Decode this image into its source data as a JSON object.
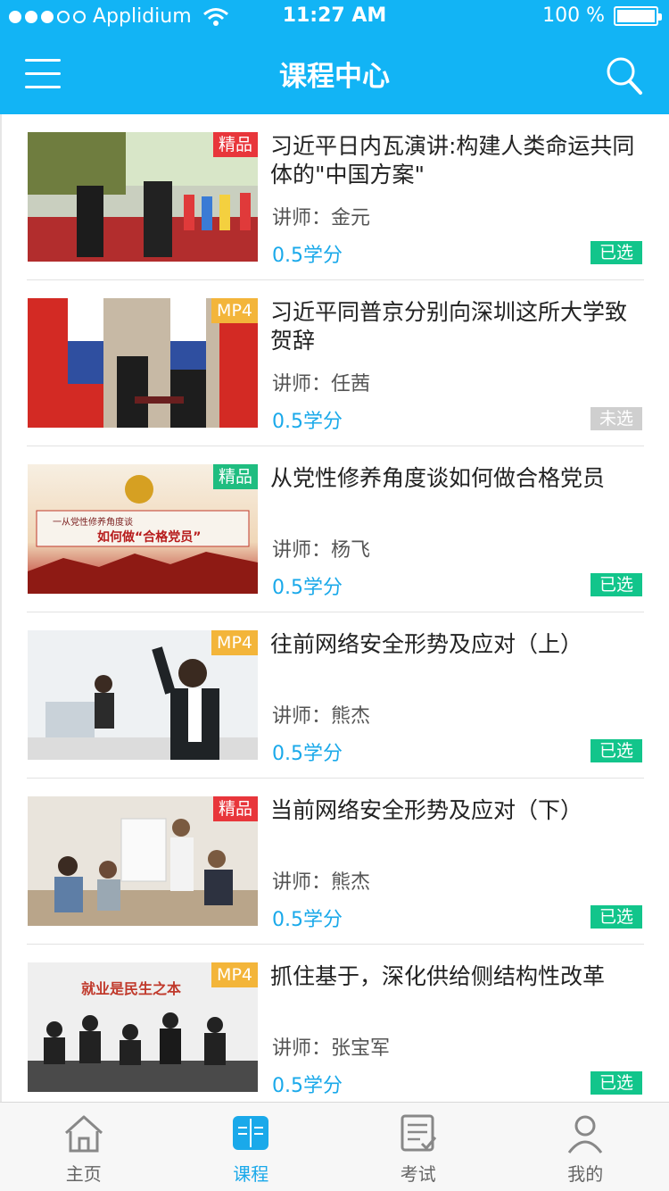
{
  "status_bar": {
    "carrier": "Applidium",
    "time": "11:27 AM",
    "battery": "100 %"
  },
  "nav": {
    "title": "课程中心"
  },
  "courses": [
    {
      "title": "习近平日内瓦演讲:构建人类命运共同体的\"中国方案\"",
      "badge": "精品",
      "teacher": "讲师：金元",
      "credit": "0.5学分",
      "state": "已选"
    },
    {
      "title": "习近平同普京分别向深圳这所大学致贺辞",
      "badge": "MP4",
      "teacher": "讲师：任茜",
      "credit": "0.5学分",
      "state": "未选"
    },
    {
      "title": " 从党性修养角度谈如何做合格党员",
      "badge": "精品",
      "teacher": "讲师：杨飞",
      "credit": "0.5学分",
      "state": "已选",
      "thumb_text_1": "一从党性修养角度谈",
      "thumb_text_2": "如何做“合格党员”"
    },
    {
      "title": "往前网络安全形势及应对（上）",
      "badge": "MP4",
      "teacher": "讲师：熊杰",
      "credit": "0.5学分",
      "state": "已选"
    },
    {
      "title": "当前网络安全形势及应对（下）",
      "badge": "精品",
      "teacher": "讲师：熊杰",
      "credit": "0.5学分",
      "state": "已选"
    },
    {
      "title": "抓住基于，深化供给侧结构性改革",
      "badge": "MP4",
      "teacher": "讲师：张宝军",
      "credit": "0.5学分",
      "state": "已选",
      "thumb_text_1": "就业是民生之本"
    }
  ],
  "tabs": [
    {
      "label": "主页",
      "icon": "home-icon"
    },
    {
      "label": "课程",
      "icon": "book-icon"
    },
    {
      "label": "考试",
      "icon": "exam-icon"
    },
    {
      "label": "我的",
      "icon": "user-icon"
    }
  ],
  "colors": {
    "primary": "#12b4f5",
    "accent_text": "#1aa9ea",
    "selected": "#12c58b",
    "unselected": "#cfcfcf",
    "badge_red": "#e8363b",
    "badge_green": "#1fbd80",
    "badge_gold": "#f3b53a"
  }
}
